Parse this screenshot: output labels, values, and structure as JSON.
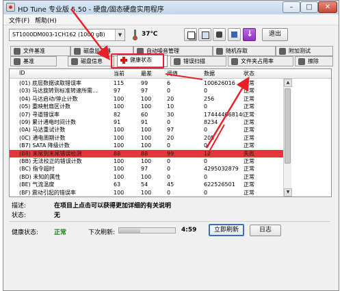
{
  "window": {
    "title": "HD Tune 专业版 5.50 - 硬盘/固态硬盘实用程序"
  },
  "menu": {
    "file": "文件(F)",
    "help": "帮助(H)"
  },
  "toolbar": {
    "drive": "ST1000DM003-1CH162 (1000 gB)",
    "temperature": "37℃",
    "exit_label": "退出",
    "icons": [
      "copy-text-icon",
      "copy-screen-icon",
      "camera-icon",
      "save-icon",
      "download-icon"
    ]
  },
  "tabs_top": [
    "文件基准",
    "磁盘监视器",
    "自动噪音管理",
    "随机存取",
    "附加测试"
  ],
  "tabs_bottom": [
    "基准",
    "磁盘信息",
    "健康状态",
    "错误扫描",
    "文件夹占用率",
    "擦除"
  ],
  "active_tab": "健康状态",
  "table": {
    "headers": [
      "ID",
      "当前",
      "最差",
      "阈值",
      "数据",
      "状态"
    ],
    "rows": [
      [
        "(01) 底层数据读取错误率",
        "115",
        "99",
        "6",
        "100626016",
        "正常"
      ],
      [
        "(03) 马达旋转到标准转速所需...",
        "97",
        "97",
        "0",
        "0",
        "正常"
      ],
      [
        "(04) 马达启动/停止计数",
        "100",
        "100",
        "20",
        "256",
        "正常"
      ],
      [
        "(05) 重映射扇区计数",
        "100",
        "100",
        "10",
        "0",
        "正常"
      ],
      [
        "(07) 寻道错误率",
        "82",
        "60",
        "30",
        "174444068140",
        "正常"
      ],
      [
        "(09) 累计通电时间计数",
        "91",
        "91",
        "0",
        "8234",
        "正常"
      ],
      [
        "(0A) 马达重试计数",
        "100",
        "100",
        "97",
        "0",
        "正常"
      ],
      [
        "(0C) 通电周期计数",
        "100",
        "100",
        "20",
        "205",
        "正常"
      ],
      [
        "(B7) SATA 降级计数",
        "100",
        "100",
        "0",
        "0",
        "正常"
      ],
      [
        "(B8) 末尾到末尾错误检测",
        "88",
        "88",
        "99",
        "12",
        "失败"
      ],
      [
        "(BB) 无法校正的错误计数",
        "100",
        "100",
        "0",
        "0",
        "正常"
      ],
      [
        "(BC) 指令超时",
        "100",
        "97",
        "0",
        "4295032879",
        "正常"
      ],
      [
        "(BD) 未知的属性",
        "100",
        "100",
        "0",
        "0",
        "正常"
      ],
      [
        "(BE) 气流温度",
        "63",
        "54",
        "45",
        "622526501",
        "正常"
      ],
      [
        "(BF) 震动引起的错误率",
        "100",
        "100",
        "0",
        "0",
        "正常"
      ]
    ]
  },
  "description": {
    "label": "描述:",
    "value": "在项目上点击可以获得更加详细的有关说明"
  },
  "state": {
    "label": "状态:",
    "value": "无"
  },
  "health": {
    "label": "健康状态:",
    "value": "正常"
  },
  "refresh": {
    "label": "下次刷新:",
    "countdown": "4:59",
    "progress": 0.38
  },
  "buttons": {
    "refresh_now": "立即刷新",
    "log": "日志"
  },
  "colors": {
    "alert_row": "#e8343a",
    "annotation": "#e8202a",
    "healthy": "#1a8a1a"
  }
}
